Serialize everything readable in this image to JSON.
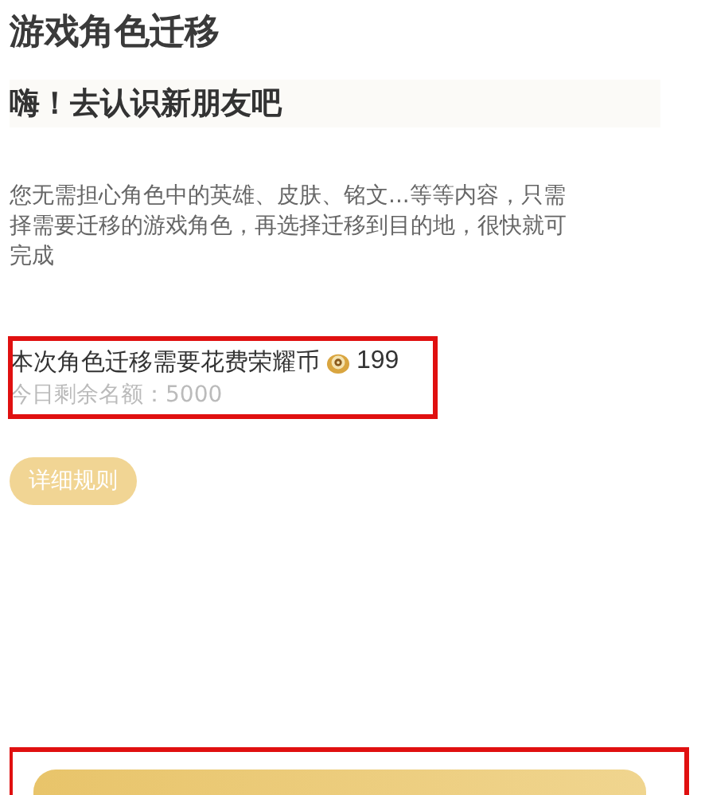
{
  "page": {
    "title": "游戏角色迁移"
  },
  "greeting": "嗨！去认识新朋友吧",
  "description_lines": [
    "您无需担心角色中的英雄、皮肤、铭文...等等内容，只需",
    "择需要迁移的游戏角色，再选择迁移到目的地，很快就可",
    "完成"
  ],
  "cost": {
    "highlighted": true,
    "label": "本次角色迁移需要花费荣耀币",
    "amount": "199",
    "quota": "今日剩余名额：5000"
  },
  "rules_button": {
    "label": "详细规则"
  },
  "action": {
    "highlighted": true
  }
}
